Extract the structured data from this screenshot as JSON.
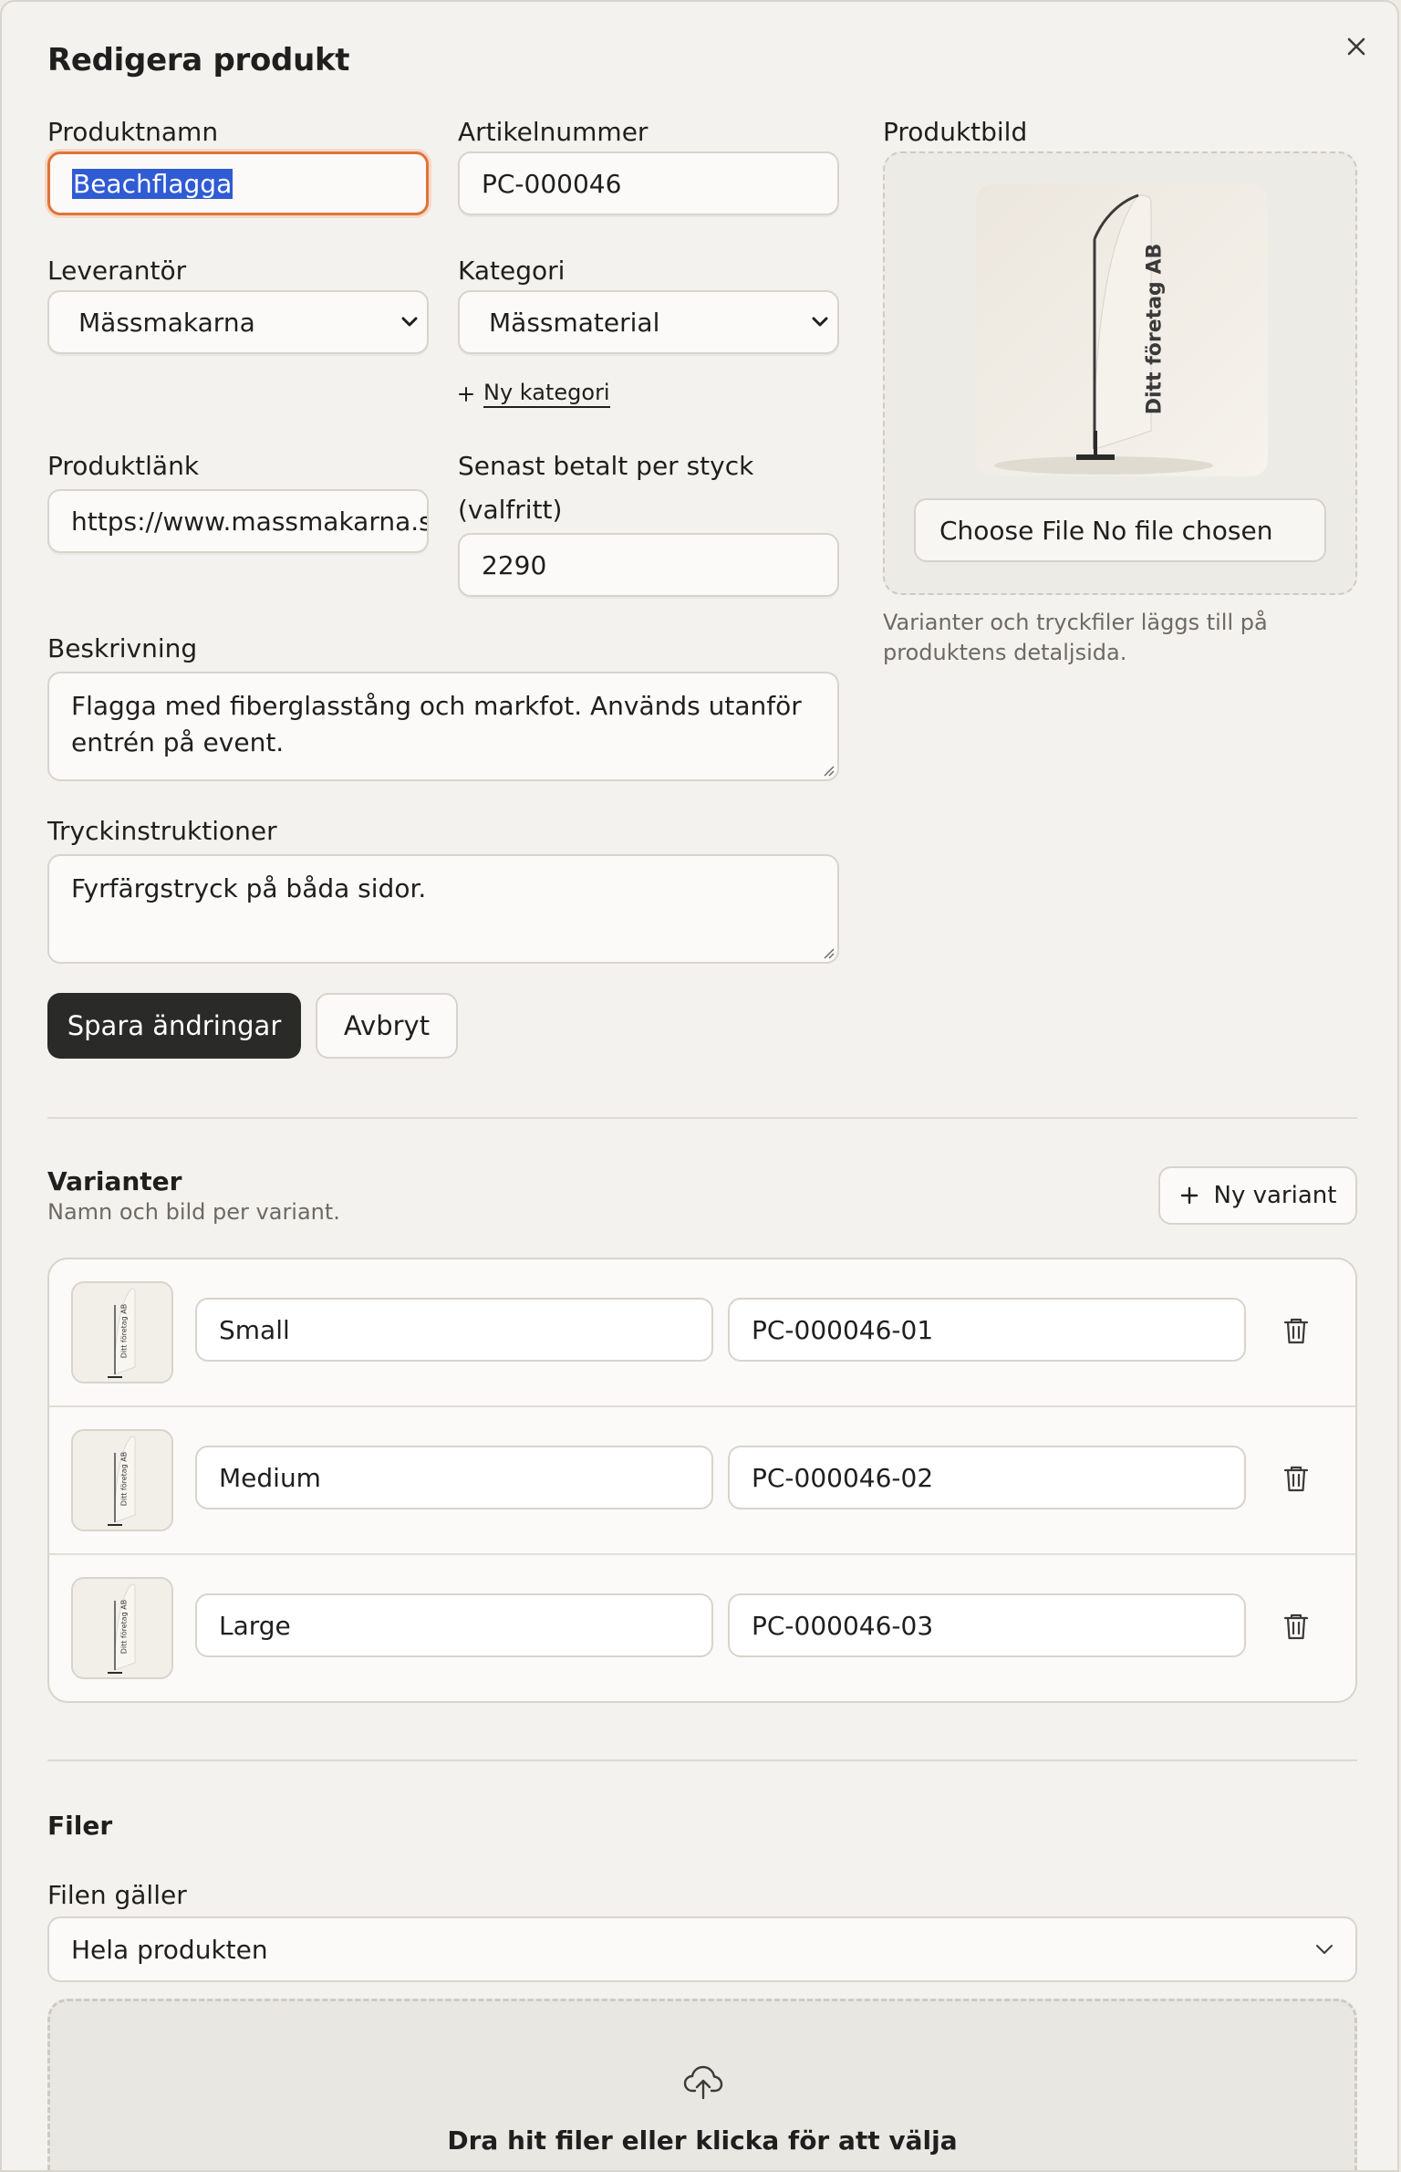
{
  "dialog": {
    "title": "Redigera produkt",
    "close_icon": "close-icon"
  },
  "form": {
    "product_name": {
      "label": "Produktnamn",
      "value": "Beachflagga"
    },
    "article_number": {
      "label": "Artikelnummer",
      "value": "PC-000046"
    },
    "supplier": {
      "label": "Leverantör",
      "value": "Mässmakarna"
    },
    "category": {
      "label": "Kategori",
      "value": "Mässmaterial",
      "new_label": "Ny kategori"
    },
    "product_link": {
      "label": "Produktlänk",
      "value": "https://www.massmakarna.se"
    },
    "last_price": {
      "label_line1": "Senast betalt per styck",
      "label_line2": "(valfritt)",
      "value": "2290"
    },
    "description": {
      "label": "Beskrivning",
      "value": "Flagga med fiberglasstång och markfot. Används utanför entrén på event."
    },
    "print_instructions": {
      "label": "Tryckinstruktioner",
      "value": "Fyrfärgstryck på båda sidor."
    },
    "product_image": {
      "label": "Produktbild",
      "flag_text": "Ditt företag AB",
      "file_button": "Choose File",
      "file_status": "No file chosen",
      "hint": "Varianter och tryckfiler läggs till på produktens detaljsida."
    },
    "save_label": "Spara ändringar",
    "cancel_label": "Avbryt"
  },
  "variants": {
    "title": "Varianter",
    "subtitle": "Namn och bild per variant.",
    "add_label": "Ny variant",
    "items": [
      {
        "name": "Small",
        "sku": "PC-000046-01",
        "thumb_text": "Ditt företag AB"
      },
      {
        "name": "Medium",
        "sku": "PC-000046-02",
        "thumb_text": "Ditt företag AB"
      },
      {
        "name": "Large",
        "sku": "PC-000046-03",
        "thumb_text": "Ditt företag AB"
      }
    ]
  },
  "files": {
    "title": "Filer",
    "applies_label": "Filen gäller",
    "applies_value": "Hela produkten",
    "dropzone_text": "Dra hit filer eller klicka för att välja"
  },
  "colors": {
    "accent_focus": "#e0733a",
    "primary_button": "#2a2a29",
    "background": "#f4f2ee"
  }
}
